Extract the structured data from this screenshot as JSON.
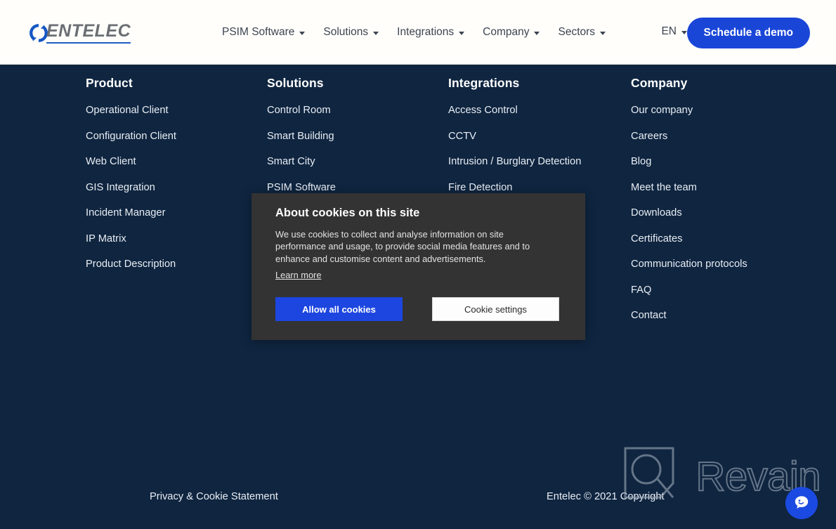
{
  "header": {
    "logo": {
      "text": "ENTELEC",
      "mark": "circular-arrows-icon"
    },
    "nav_items": [
      {
        "label": "PSIM Software",
        "has_dropdown": true
      },
      {
        "label": "Solutions",
        "has_dropdown": true
      },
      {
        "label": "Integrations",
        "has_dropdown": true
      },
      {
        "label": "Company",
        "has_dropdown": true
      },
      {
        "label": "Sectors",
        "has_dropdown": true
      }
    ],
    "language": {
      "label": "EN",
      "has_dropdown": true
    },
    "cta": {
      "label": "Schedule a demo",
      "color": "#1a46d8"
    }
  },
  "footer": {
    "background": "#0f2540",
    "columns": [
      {
        "title": "Product",
        "links": [
          "Operational Client",
          "Configuration Client",
          "Web Client",
          "GIS Integration",
          "Incident Manager",
          "IP Matrix",
          "Product Description"
        ]
      },
      {
        "title": "Solutions",
        "links": [
          "Control Room",
          "Smart Building",
          "Smart City",
          "PSIM Software"
        ]
      },
      {
        "title": "Integrations",
        "links": [
          "Access Control",
          "CCTV",
          "Intrusion / Burglary Detection",
          "Fire Detection"
        ]
      },
      {
        "title": "Company",
        "links": [
          "Our company",
          "Careers",
          "Blog",
          "Meet the team",
          "Downloads",
          "Certificates",
          "Communication protocols",
          "FAQ",
          "Contact"
        ]
      }
    ],
    "bottom": {
      "privacy_link": "Privacy & Cookie Statement",
      "copyright": "Entelec © 2021 Copyright"
    }
  },
  "cookie_dialog": {
    "title": "About cookies on this site",
    "body": "We use cookies to collect and analyse information on site performance and usage, to provide social media features and to enhance and customise content and advertisements.",
    "learn_more": "Learn more",
    "allow_button": "Allow all cookies",
    "settings_button": "Cookie settings",
    "background": "#333333",
    "allow_color": "#1d46e0"
  },
  "watermark": {
    "brand": "Revain",
    "mark": "revain-logo-icon",
    "color": "#9aa6b4"
  },
  "chat_widget": {
    "icon": "chat-bubble-icon",
    "color": "#1b4ae2"
  }
}
